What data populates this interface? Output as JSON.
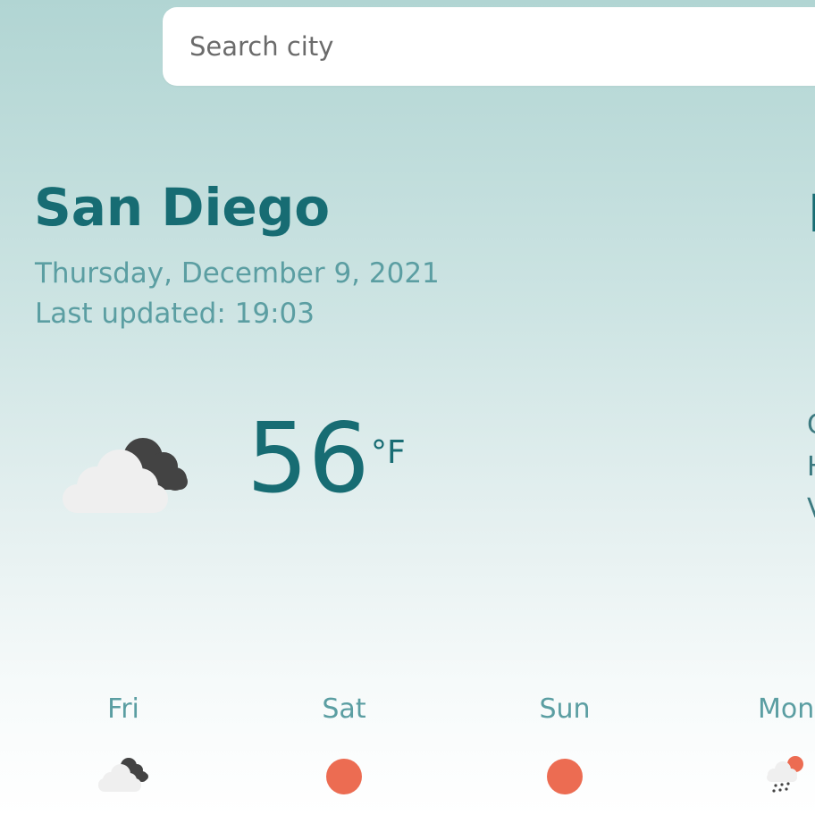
{
  "search": {
    "placeholder": "Search city"
  },
  "location": {
    "city": "San Diego",
    "date": "Thursday, December 9, 2021",
    "last_updated": "Last updated: 19:03"
  },
  "current": {
    "icon": "partly-cloudy-icon",
    "temperature": "56",
    "unit": "°F"
  },
  "details_panel_partial": {
    "heading": "I",
    "lines": [
      "C",
      "H",
      "V"
    ]
  },
  "forecast": [
    {
      "day": "Fri",
      "icon": "partly-cloudy-icon"
    },
    {
      "day": "Sat",
      "icon": "sun-icon"
    },
    {
      "day": "Sun",
      "icon": "sun-icon"
    },
    {
      "day": "Mon",
      "icon": "rain-icon"
    }
  ],
  "colors": {
    "primary_text": "#176c73",
    "secondary_text": "#5b9ea2",
    "sun": "#ec6c52",
    "cloud_light": "#efefef",
    "cloud_dark": "#434343"
  }
}
